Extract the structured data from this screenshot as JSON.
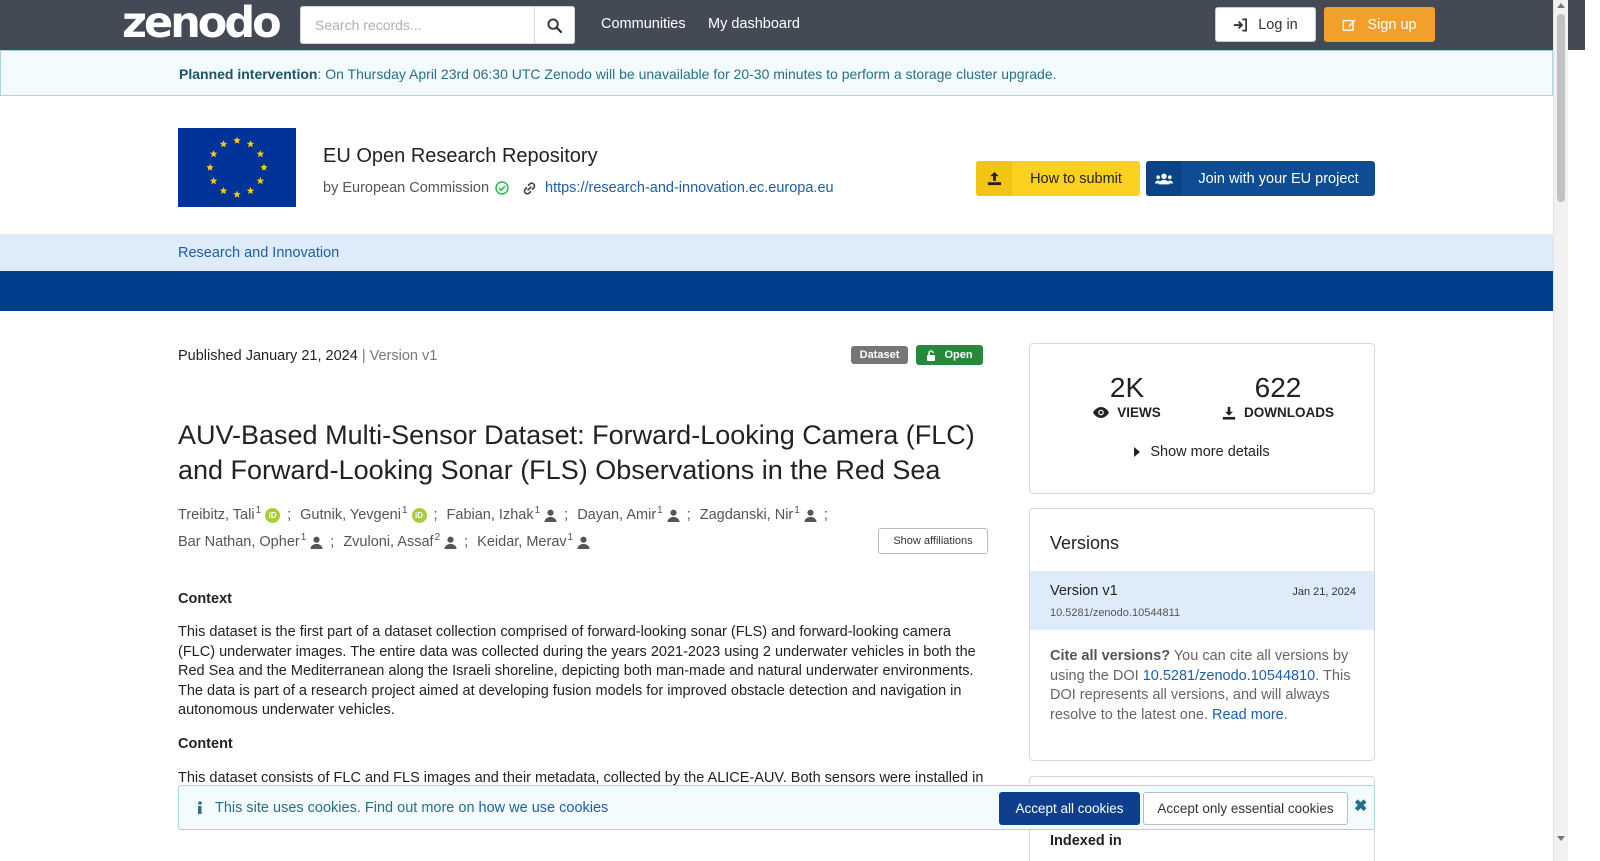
{
  "topnav": {
    "logo": "zenodo",
    "search_placeholder": "Search records...",
    "links": [
      "Communities",
      "My dashboard"
    ],
    "login": "Log in",
    "signup": "Sign up"
  },
  "banner": {
    "strong": "Planned intervention",
    "text": ": On Thursday April 23rd 06:30 UTC Zenodo will be unavailable for 20-30 minutes to perform a storage cluster upgrade."
  },
  "community": {
    "title": "EU Open Research Repository",
    "by": "by European Commission",
    "url": "https://research-and-innovation.ec.europa.eu",
    "submit_button": "How to submit",
    "join_button": "Join with your EU project",
    "subnav_item": "Research and Innovation"
  },
  "record": {
    "published": "Published January 21, 2024",
    "version": "| Version v1",
    "resource_type": "Dataset",
    "access": "Open",
    "title": "AUV-Based Multi-Sensor Dataset: Forward-Looking Camera (FLC) and Forward-Looking Sonar (FLS) Observations in the Red Sea",
    "creators": [
      {
        "name": "Treibitz, Tali",
        "aff": "1",
        "badge": "orcid",
        "sep": ";"
      },
      {
        "name": "Gutnik, Yevgeni",
        "aff": "1",
        "badge": "orcid",
        "sep": ";"
      },
      {
        "name": "Fabian, Izhak",
        "aff": "1",
        "badge": "person",
        "sep": ";"
      },
      {
        "name": "Dayan, Amir",
        "aff": "1",
        "badge": "person",
        "sep": ";"
      },
      {
        "name": "Zagdanski, Nir",
        "aff": "1",
        "badge": "person",
        "sep": ";"
      },
      {
        "name": "Bar Nathan, Opher",
        "aff": "1",
        "badge": "person",
        "sep": ";"
      },
      {
        "name": "Zvuloni, Assaf",
        "aff": "2",
        "badge": "person",
        "sep": ";"
      },
      {
        "name": "Keidar, Merav",
        "aff": "1",
        "badge": "person",
        "sep": ""
      }
    ],
    "show_affiliations": "Show affiliations",
    "context_heading": "Context",
    "context_text": "This dataset is the first part of a dataset collection comprised of forward-looking sonar (FLS) and forward-looking camera (FLC) underwater images. The entire data was collected during the years 2021-2023 using 2 underwater vehicles in both the Red Sea and the Mediterranean along the Israeli shoreline, depicting both man-made and natural underwater environments. The data is part of a research project aimed at developing fusion models for improved obstacle detection and navigation in autonomous underwater vehicles.",
    "content_heading": "Content",
    "content_text": "This dataset consists of FLC and FLS images and their metadata, collected by the ALICE-AUV. Both sensors were installed in the"
  },
  "stats": {
    "views": "2K",
    "views_label": "VIEWS",
    "downloads": "622",
    "downloads_label": "DOWNLOADS",
    "more": "Show more details"
  },
  "versions": {
    "heading": "Versions",
    "current": {
      "name": "Version v1",
      "date": "Jan 21, 2024",
      "doi": "10.5281/zenodo.10544811"
    },
    "cite_strong": "Cite all versions?",
    "cite_text_1": " You can cite all versions by using the DOI ",
    "cite_doi": "10.5281/zenodo.10544810",
    "cite_text_2": ". This DOI represents all versions, and will always resolve to the latest one. ",
    "read_more": "Read more",
    "period": "."
  },
  "indexed": {
    "heading": "Indexed in"
  },
  "cookie": {
    "text": "This site uses cookies. Find out more on ",
    "link": "how we use cookies",
    "accept_all": "Accept all cookies",
    "accept_essential": "Accept only essential cookies"
  }
}
